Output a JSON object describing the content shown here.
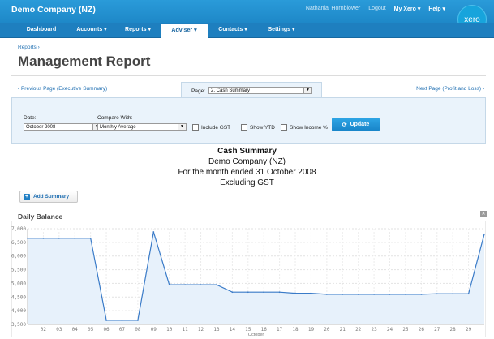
{
  "header": {
    "company": "Demo Company (NZ)",
    "user": "Nathanial Hornblower",
    "logout": "Logout",
    "my_xero": "My Xero",
    "help": "Help",
    "logo": "xero"
  },
  "nav": {
    "tabs": [
      {
        "label": "Dashboard"
      },
      {
        "label": "Accounts"
      },
      {
        "label": "Reports"
      },
      {
        "label": "Adviser"
      },
      {
        "label": "Contacts"
      },
      {
        "label": "Settings"
      }
    ],
    "active": "Adviser"
  },
  "breadcrumb": "Reports ›",
  "page_title": "Management Report",
  "pager": {
    "prev": "‹ Previous Page (Executive Summary)",
    "next": "Next Page (Profit and Loss) ›",
    "page_label": "Page:",
    "page_value": "2. Cash Summary"
  },
  "filters": {
    "date_label": "Date:",
    "date_value": "October 2008",
    "compare_label": "Compare With:",
    "compare_value": "Monthly Average",
    "include_gst": "Include GST",
    "show_ytd": "Show YTD",
    "show_income_pct": "Show Income %",
    "update": "Update"
  },
  "report": {
    "title": "Cash Summary",
    "company": "Demo Company (NZ)",
    "period": "For the month ended 31 October 2008",
    "basis": "Excluding GST"
  },
  "add_summary": "Add Summary",
  "section_title": "Daily Balance",
  "colors": {
    "accent": "#1f7fc4",
    "line": "#3a7bc8",
    "fill": "#e7f1fb"
  },
  "chart_data": {
    "type": "line",
    "title": "",
    "xlabel": "October",
    "ylabel": "",
    "ylim": [
      3500,
      7000
    ],
    "yticks": [
      3500,
      4000,
      4500,
      5000,
      5500,
      6000,
      6500,
      7000
    ],
    "ytick_labels": [
      "3,500",
      "4,000",
      "4,500",
      "5,000",
      "5,500",
      "6,000",
      "6,500",
      "7,000"
    ],
    "x": [
      "01",
      "02",
      "03",
      "04",
      "05",
      "06",
      "07",
      "08",
      "09",
      "10",
      "11",
      "12",
      "13",
      "14",
      "15",
      "16",
      "17",
      "18",
      "19",
      "20",
      "21",
      "22",
      "23",
      "24",
      "25",
      "26",
      "27",
      "28",
      "29",
      "30"
    ],
    "xtick_labels": [
      "02",
      "03",
      "04",
      "05",
      "06",
      "07",
      "08",
      "09",
      "10",
      "11",
      "12",
      "13",
      "14",
      "15",
      "16",
      "17",
      "18",
      "19",
      "20",
      "21",
      "22",
      "23",
      "24",
      "25",
      "26",
      "27",
      "28",
      "29"
    ],
    "values": [
      6650,
      6650,
      6650,
      6650,
      6650,
      3650,
      3650,
      3650,
      6880,
      4950,
      4950,
      4950,
      4950,
      4680,
      4680,
      4680,
      4680,
      4640,
      4640,
      4600,
      4600,
      4600,
      4600,
      4600,
      4600,
      4600,
      4620,
      4620,
      4620,
      6800
    ],
    "grid": true,
    "legend": "none"
  }
}
